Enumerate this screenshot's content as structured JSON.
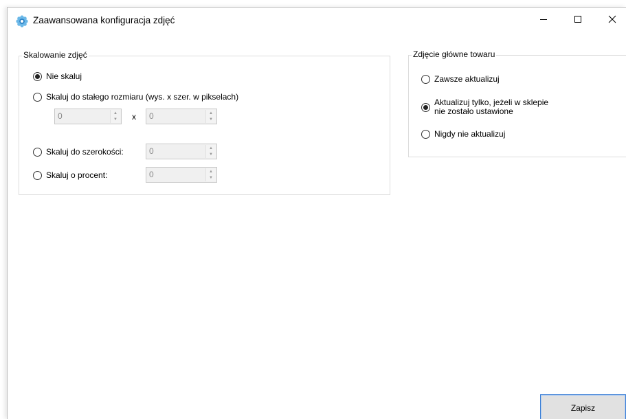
{
  "window": {
    "title": "Zaawansowana konfiguracja zdjęć",
    "app_icon": "gear-flower-icon",
    "controls": {
      "minimize": "minimize-icon",
      "maximize": "maximize-icon",
      "close": "close-icon"
    }
  },
  "scaling": {
    "legend": "Skalowanie zdjęć",
    "options": [
      {
        "label": "Nie skaluj",
        "selected": true
      },
      {
        "label": "Skaluj do stałego rozmiaru (wys. x szer. w pikselach)",
        "selected": false
      },
      {
        "label": "Skaluj do szerokości:",
        "selected": false
      },
      {
        "label": "Skaluj o procent:",
        "selected": false
      }
    ],
    "fixed_height_value": "0",
    "times_sign": "x",
    "fixed_width_value": "0",
    "width_value": "0",
    "percent_value": "0"
  },
  "main_photo": {
    "legend": "Zdjęcie główne towaru",
    "options": [
      {
        "label": "Zawsze aktualizuj",
        "selected": false
      },
      {
        "label_line1": "Aktualizuj tylko, jeżeli w sklepie",
        "label_line2": "nie zostało ustawione",
        "selected": true
      },
      {
        "label": "Nigdy nie aktualizuj",
        "selected": false
      }
    ]
  },
  "buttons": {
    "save_label": "Zapisz"
  },
  "colors": {
    "focus_border": "#3c7fd6",
    "button_bg": "#e1e1e1",
    "icon_blue": "#4aa3df"
  }
}
